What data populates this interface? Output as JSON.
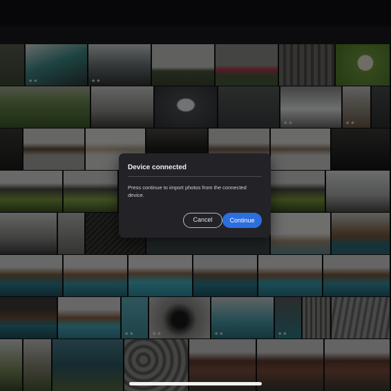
{
  "dialog": {
    "title": "Device connected",
    "message": "Press continue to import photos from the connected device.",
    "cancel_label": "Cancel",
    "continue_label": "Continue"
  },
  "thumbnail_rating": "★★",
  "colors": {
    "accent": "#2b6ee0",
    "dialog_bg": "#232227"
  },
  "icons": [
    "rating-stars-icon"
  ]
}
